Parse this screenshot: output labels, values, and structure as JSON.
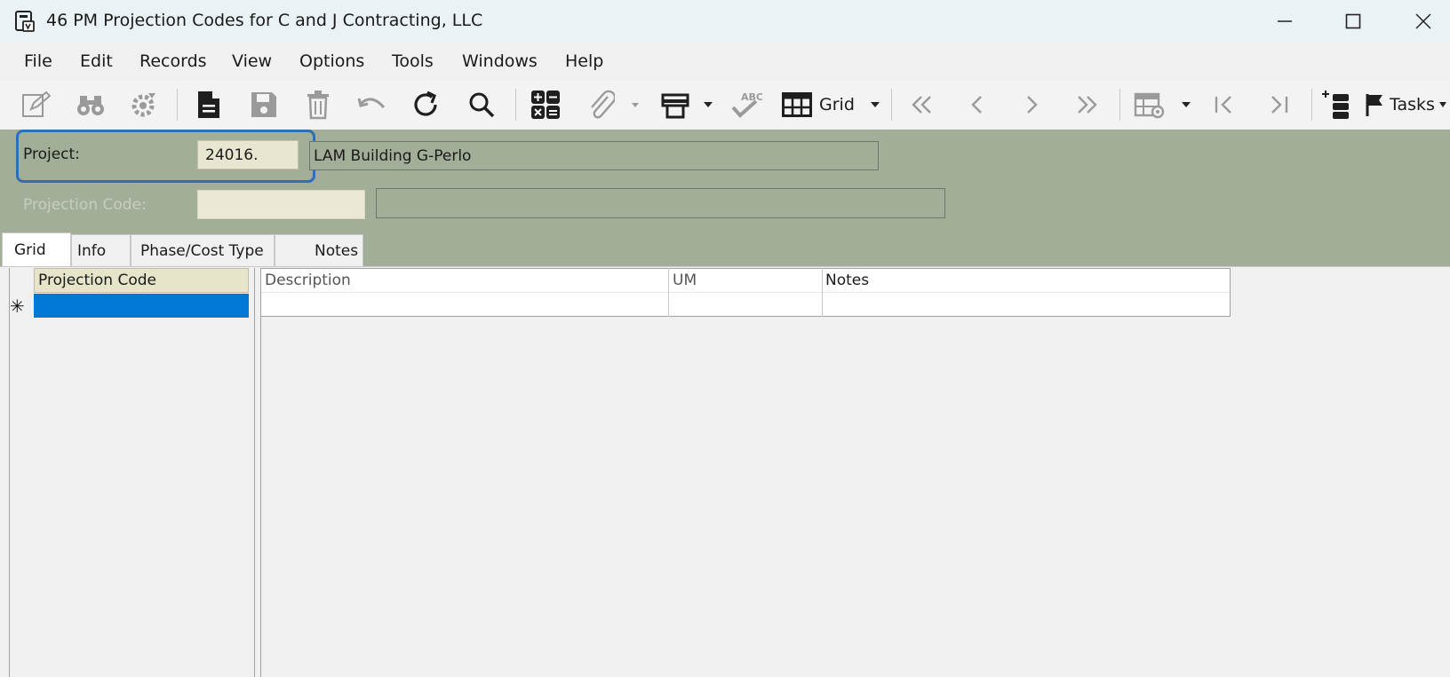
{
  "window": {
    "title": "46 PM Projection Codes for C and J Contracting, LLC",
    "icons": {
      "app": "app-form-icon",
      "minimize": "minimize-icon",
      "maximize": "maximize-icon",
      "close": "close-icon"
    }
  },
  "menu": {
    "items": [
      "File",
      "Edit",
      "Records",
      "View",
      "Options",
      "Tools",
      "Windows",
      "Help"
    ]
  },
  "toolbar": {
    "grid_label": "Grid",
    "tasks_label": "Tasks",
    "icons": [
      "edit-icon",
      "binoculars-icon",
      "settings-gear-icon",
      "new-document-icon",
      "save-icon",
      "delete-icon",
      "undo-icon",
      "refresh-icon",
      "search-icon",
      "calculator-icon",
      "attachment-icon",
      "print-icon",
      "spellcheck-icon",
      "grid-icon",
      "first-record-icon",
      "previous-record-icon",
      "next-record-icon",
      "last-record-icon",
      "table-settings-icon",
      "first-icon",
      "last-icon",
      "add-record-icon",
      "flag-icon"
    ]
  },
  "form": {
    "project_label": "Project:",
    "project_value": "24016.",
    "project_description": "LAM Building G-Perlo",
    "projection_code_label": "Projection Code:",
    "projection_code_value": "",
    "projection_code_description": ""
  },
  "tabs": [
    "Grid",
    "Info",
    "Phase/Cost Type",
    "Notes"
  ],
  "active_tab": "Grid",
  "grid": {
    "columns": [
      "Projection Code",
      "Description",
      "UM",
      "Notes"
    ],
    "new_row_marker": "✳",
    "rows": []
  },
  "colors": {
    "header_background": "#a3ae98",
    "focus_ring": "#2f6fb5",
    "selected_cell": "#0078d7",
    "code_field": "#e8e6d0"
  }
}
